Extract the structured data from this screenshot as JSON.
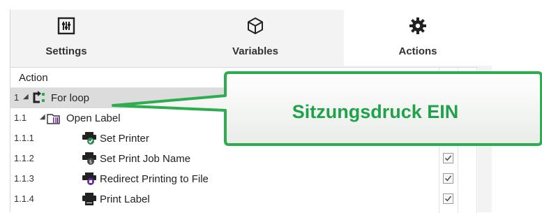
{
  "tabs": [
    {
      "label": "Settings",
      "icon": "settings-sliders-icon",
      "active": false
    },
    {
      "label": "Variables",
      "icon": "cube-icon",
      "active": false
    },
    {
      "label": "Actions",
      "icon": "gear-icon",
      "active": true
    }
  ],
  "table": {
    "header": "Action",
    "rows": [
      {
        "number": "1",
        "label": "For loop",
        "icon": "loop-icon",
        "expanded": true,
        "selected": true
      },
      {
        "number": "1.1",
        "label": "Open Label",
        "icon": "open-label-icon",
        "expanded": true,
        "selected": false
      },
      {
        "number": "1.1.1",
        "label": "Set Printer",
        "icon": "set-printer-icon",
        "checked": true
      },
      {
        "number": "1.1.2",
        "label": "Set Print Job Name",
        "icon": "print-job-name-icon",
        "checked": true
      },
      {
        "number": "1.1.3",
        "label": "Redirect Printing to File",
        "icon": "redirect-printing-icon",
        "checked": true
      },
      {
        "number": "1.1.4",
        "label": "Print Label",
        "icon": "print-label-icon",
        "checked": true
      }
    ]
  },
  "callout": {
    "text": "Sitzungsdruck EIN",
    "color": "#1fa34a"
  }
}
